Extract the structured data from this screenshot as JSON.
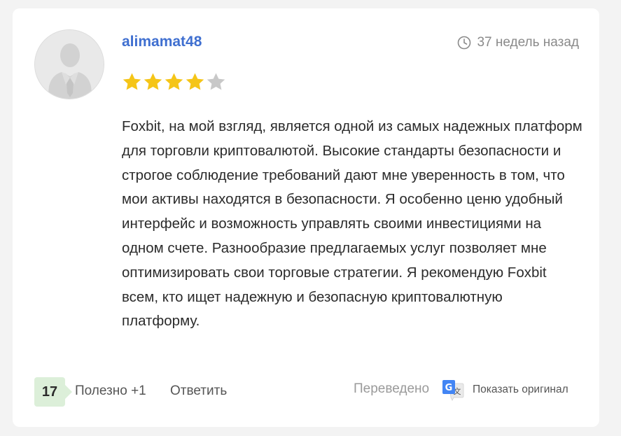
{
  "review": {
    "username": "alimamat48",
    "time_ago": "37 недель назад",
    "rating": 4,
    "rating_max": 5,
    "star_color_filled": "#f5c518",
    "star_color_empty": "#c8c8c8",
    "text": "Foxbit, на мой взгляд, является одной из самых надежных платформ для торговли криптовалютой. Высокие стандарты безопасности и строгое соблюдение требований дают мне уверенность в том, что мои активы находятся в безопасности. Я особенно ценю удобный интерфейс и возможность управлять своими инвестициями на одном счете. Разнообразие предлагаемых услуг позволяет мне оптимизировать свои торговые стратегии. Я рекомендую Foxbit всем, кто ищет надежную и безопасную криптовалютную платформу."
  },
  "footer": {
    "vote_count": "17",
    "useful_label": "Полезно +1",
    "reply_label": "Ответить",
    "translated_label": "Переведено",
    "show_original_label": "Показать оригинал"
  },
  "icons": {
    "avatar": "user-silhouette-icon",
    "clock": "clock-icon",
    "translate": "google-translate-icon"
  },
  "colors": {
    "username": "#3f6fd0",
    "vote_badge_bg": "#dcefd9",
    "muted_text": "#8a8a8a"
  }
}
